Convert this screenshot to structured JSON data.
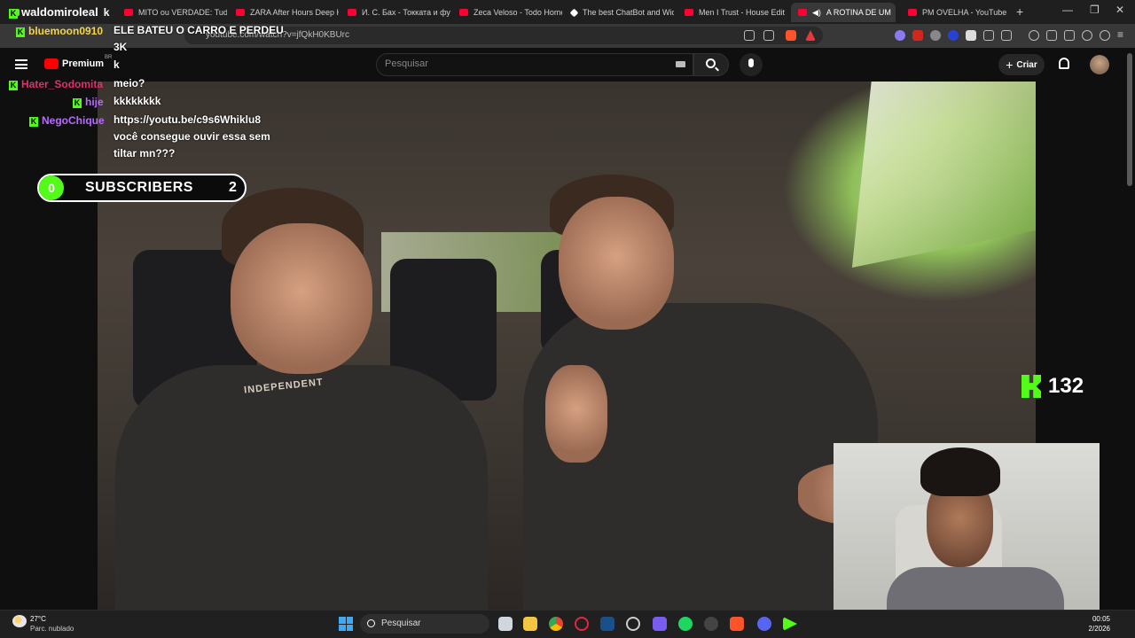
{
  "browser": {
    "tabs": [
      {
        "label": "MITO ou VERDADE: Tudo"
      },
      {
        "label": "ZARA After Hours Deep H"
      },
      {
        "label": "И. С. Бах - Токката и фуга"
      },
      {
        "label": "Zeca Veloso - Todo Homem"
      },
      {
        "label": "The best ChatBot and Wid"
      },
      {
        "label": "Men I Trust - House Edit M"
      },
      {
        "label": "A ROTINA DE UM"
      },
      {
        "label": "PM OVELHA - YouTube"
      }
    ],
    "url": "youtube.com/watch?v=jfQkH0KBUrc"
  },
  "youtube": {
    "logo_text": "Premium",
    "region": "BR",
    "search_placeholder": "Pesquisar",
    "create_label": "Criar"
  },
  "chat": [
    {
      "user": "waldomiroleal",
      "user_color": "#ffffff",
      "message": "k"
    },
    {
      "user": "bluemoon0910",
      "user_color": "#f5d547",
      "message": "ELE BATEU O CARRO E PERDEU"
    },
    {
      "user": "",
      "user_color": "#ffffff",
      "message": "3K"
    },
    {
      "user": "",
      "user_color": "#ffffff",
      "message": "k"
    },
    {
      "user": "Hater_Sodomita",
      "user_color": "#e0306b",
      "message": "meio?"
    },
    {
      "user": "hije",
      "user_color": "#b66bff",
      "message": "kkkkkkkk"
    },
    {
      "user": "NegoChique",
      "user_color": "#b66bff",
      "message": "https://youtu.be/c9s6Whiklu8"
    },
    {
      "user": "",
      "user_color": "#ffffff",
      "message": "você consegue ouvir essa sem"
    },
    {
      "user": "",
      "user_color": "#ffffff",
      "message": "tiltar mn???"
    }
  ],
  "overlay": {
    "subs_current": "0",
    "subs_label": "SUBSCRIBERS",
    "subs_goal": "2",
    "viewer_count": "132",
    "accent_color": "#53fc18"
  },
  "video": {
    "shirt_print": "INDEPENDENT"
  },
  "taskbar": {
    "temperature": "27°C",
    "condition": "Parc. nublado",
    "search_label": "Pesquisar",
    "time": "00:05",
    "date": "2/2026"
  }
}
